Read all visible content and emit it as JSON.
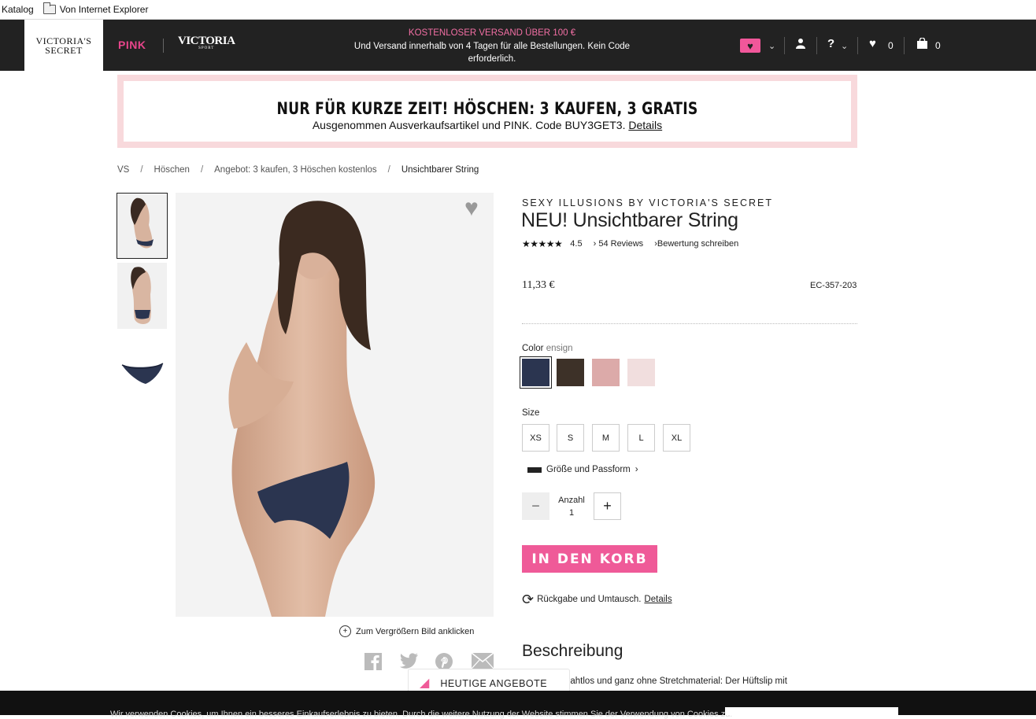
{
  "favorites": {
    "items": [
      "Katalog",
      "Von Internet Explorer"
    ]
  },
  "header": {
    "brand_line1": "VICTORIA'S",
    "brand_line2": "SECRET",
    "pink": "PINK",
    "sport_main": "VICTORIA",
    "sport_sub": "SPORT",
    "promo_title": "KOSTENLOSER VERSAND ÜBER 100 €",
    "promo_text": "Und Versand innerhalb von 4 Tagen für alle Bestellungen. Kein Code erforderlich.",
    "wishlist_count": "0",
    "bag_count": "0",
    "help_label": "?"
  },
  "banner": {
    "title": "NUR FÜR KURZE ZEIT! HÖSCHEN: 3 KAUFEN, 3 GRATIS",
    "subtitle": "Ausgenommen Ausverkaufsartikel und PINK. Code BUY3GET3.",
    "details_link": "Details"
  },
  "breadcrumb": {
    "items": [
      "VS",
      "Höschen",
      "Angebot: 3 kaufen, 3 Höschen kostenlos",
      "Unsichtbarer String"
    ],
    "separator": "/"
  },
  "gallery": {
    "zoom_label": "Zum Vergrößern Bild anklicken"
  },
  "product": {
    "brand": "SEXY ILLUSIONS BY VICTORIA'S SECRET",
    "title": "NEU! Unsichtbarer String",
    "rating_stars": "★★★★★",
    "rating": 4.5,
    "rating_text": "4.5",
    "reviews_link": "54 Reviews",
    "write_review_link": "Bewertung schreiben",
    "price": "11,33 €",
    "sku": "EC-357-203",
    "color_label": "Color",
    "color_value": "ensign",
    "colors": [
      "#2b3550",
      "#3d3128",
      "#dcaaa9",
      "#f1dede"
    ],
    "size_label": "Size",
    "sizes": [
      "XS",
      "S",
      "M",
      "L",
      "XL"
    ],
    "fit_link": "Größe und Passform",
    "quantity_label": "Anzahl",
    "quantity_value": "1",
    "cart_button": "IN DEN KORB",
    "returns_text": "Rückgabe und Umtausch.",
    "returns_link": "Details",
    "description_heading": "Beschreibung",
    "description_text": "nahtlos und ganz ohne Stretchmaterial: Der Hüftslip mit"
  },
  "deals_tab": {
    "label": "HEUTIGE ANGEBOTE"
  },
  "cookie": {
    "text": "Wir verwenden Cookies, um Ihnen ein besseres Einkaufserlebnis zu bieten. Durch die weitere Nutzung der Website stimmen Sie der Verwendung von Cookies zu."
  }
}
